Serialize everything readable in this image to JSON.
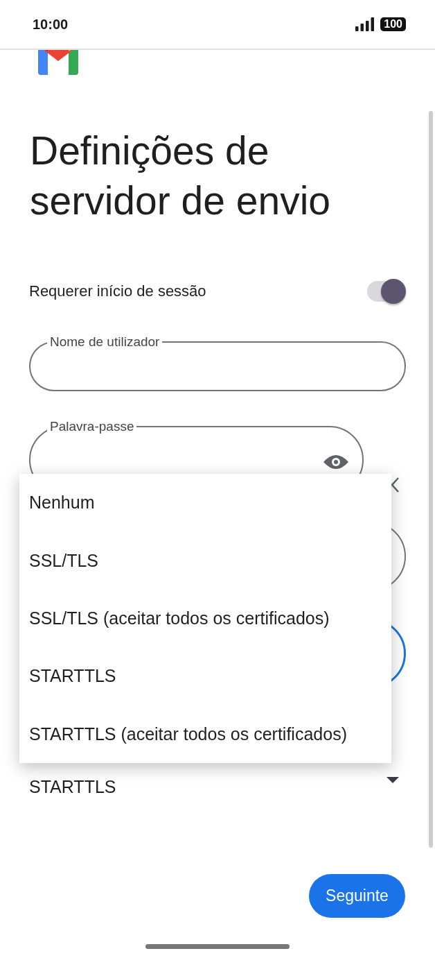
{
  "status_bar": {
    "time": "10:00",
    "battery": "100"
  },
  "title": "Definições de servidor de envio",
  "require_signin": {
    "label": "Requerer início de sessão",
    "on": true
  },
  "fields": [
    {
      "kind": "text",
      "label": "Nome de utilizador",
      "focused": false
    },
    {
      "kind": "password",
      "label": "Palavra-passe",
      "focused": false
    },
    {
      "kind": "hidden",
      "focused": false
    },
    {
      "kind": "hidden",
      "focused": true
    }
  ],
  "security": {
    "value": "STARTTLS"
  },
  "menu": {
    "options": [
      {
        "label": "Nenhum"
      },
      {
        "label": "SSL/TLS"
      },
      {
        "label": "SSL/TLS (aceitar todos os certificados)"
      },
      {
        "label": "STARTTLS"
      },
      {
        "label": "STARTTLS (aceitar todos os certificados)"
      }
    ]
  },
  "next_button": "Seguinte"
}
